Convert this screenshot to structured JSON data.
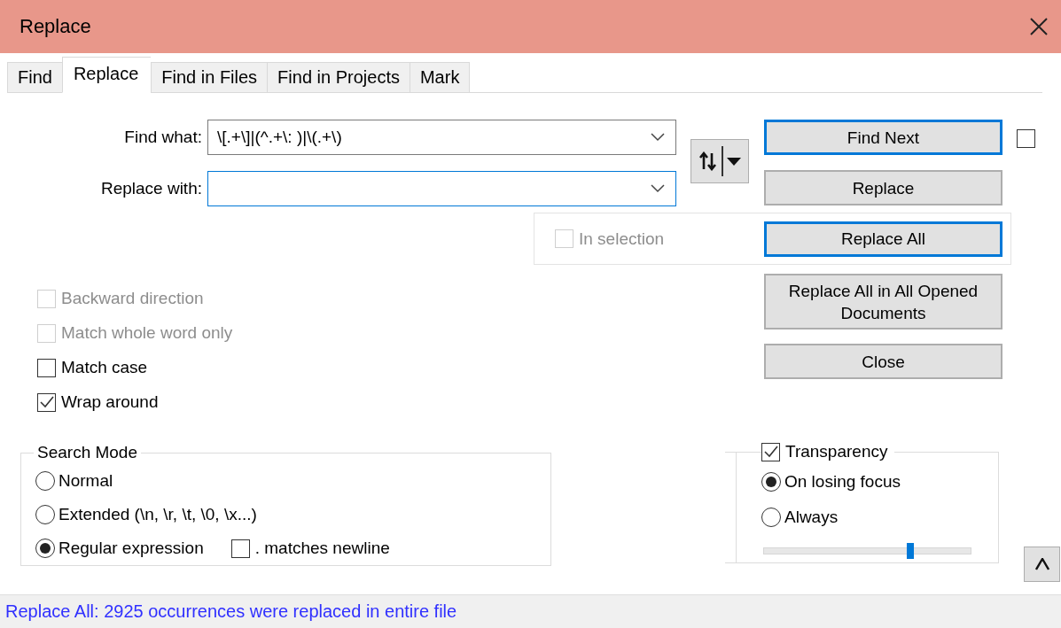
{
  "window": {
    "title": "Replace"
  },
  "tabs": [
    {
      "label": "Find",
      "selected": false
    },
    {
      "label": "Replace",
      "selected": true
    },
    {
      "label": "Find in Files",
      "selected": false
    },
    {
      "label": "Find in Projects",
      "selected": false
    },
    {
      "label": "Mark",
      "selected": false
    }
  ],
  "fields": [
    {
      "label": "Find what:",
      "value": "\\[.+\\]|(^.+\\: )|\\(.+\\)",
      "focused": false
    },
    {
      "label": "Replace with:",
      "focused": true
    }
  ],
  "buttons": [
    {
      "label": "Find Next",
      "focused": true
    },
    {
      "label": "Replace",
      "focused": false
    },
    {
      "label": "Replace All",
      "focused": true
    },
    {
      "label": "Replace All in All Opened Documents",
      "focused": false
    },
    {
      "label": "Close",
      "focused": false
    }
  ],
  "side_checkbox": {
    "checked": false
  },
  "in_selection": {
    "label": "In selection",
    "checked": false,
    "disabled": true
  },
  "options": [
    {
      "label": "Backward direction",
      "checked": false,
      "disabled": true
    },
    {
      "label": "Match whole word only",
      "checked": false,
      "disabled": true
    },
    {
      "label": "Match case",
      "checked": false,
      "disabled": false
    },
    {
      "label": "Wrap around",
      "checked": true,
      "disabled": false
    }
  ],
  "search_mode": {
    "title": "Search Mode",
    "options": [
      {
        "label": "Normal",
        "selected": false
      },
      {
        "label": "Extended (\\n, \\r, \\t, \\0, \\x...)",
        "selected": false
      },
      {
        "label": "Regular expression",
        "selected": true
      }
    ],
    "dot_matches_newline": {
      "label": ". matches newline",
      "checked": false,
      "disabled": false
    }
  },
  "transparency": {
    "label": "Transparency",
    "checked": true,
    "disabled": false,
    "options": [
      {
        "label": "On losing focus",
        "selected": true
      },
      {
        "label": "Always",
        "selected": false
      }
    ],
    "slider": {
      "level": 0.71
    }
  },
  "status_bar": {
    "message": "Replace All: 2925 occurrences were replaced in entire file"
  }
}
